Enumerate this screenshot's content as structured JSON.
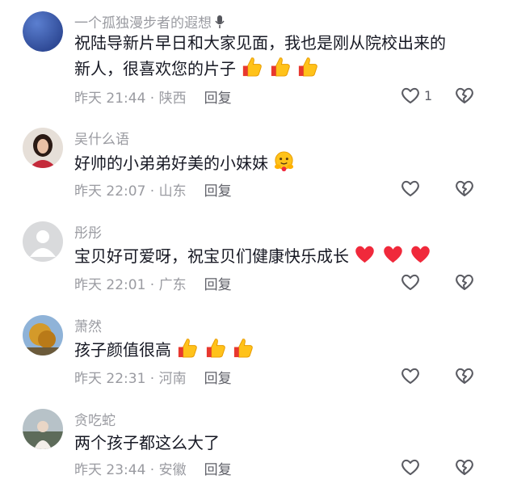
{
  "comments": [
    {
      "username": "一个孤独漫步者的遐想",
      "text_line1": "祝陆导新片早日和大家见面，我也是刚从院校出来的",
      "text_line2": "新人，很喜欢您的片子",
      "time": "昨天 21:44",
      "location": "陕西",
      "reply_label": "回复",
      "like_count": "1",
      "emojis": [
        "thumbs-up",
        "thumbs-up",
        "thumbs-up"
      ]
    },
    {
      "username": "吴什么语",
      "text": "好帅的小弟弟好美的小妹妹",
      "time": "昨天 22:07",
      "location": "山东",
      "reply_label": "回复",
      "emojis": [
        "hug-face"
      ]
    },
    {
      "username": "彤彤",
      "text": "宝贝好可爱呀，祝宝贝们健康快乐成长",
      "time": "昨天 22:01",
      "location": "广东",
      "reply_label": "回复",
      "emojis": [
        "red-heart",
        "red-heart",
        "red-heart"
      ]
    },
    {
      "username": "萧然",
      "text": "孩子颜值很高",
      "time": "昨天 22:31",
      "location": "河南",
      "reply_label": "回复",
      "emojis": [
        "thumbs-up",
        "thumbs-up",
        "thumbs-up"
      ]
    },
    {
      "username": "贪吃蛇",
      "text": "两个孩子都这么大了",
      "time": "昨天 23:44",
      "location": "安徽",
      "reply_label": "回复"
    }
  ],
  "meta_separator": " · ",
  "colors": {
    "secondary_text": "#9a9ba1",
    "primary_text": "#161823",
    "heart_red": "#f0293b",
    "thumb_yellow": "#ffc21a"
  }
}
